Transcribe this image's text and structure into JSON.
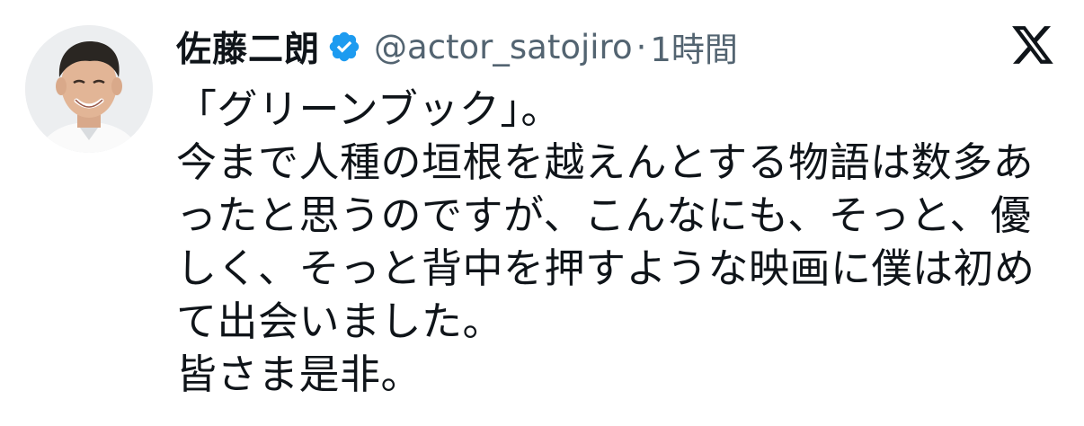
{
  "tweet": {
    "display_name": "佐藤二朗",
    "handle": "@actor_satojiro",
    "separator": "·",
    "timestamp": "1時間",
    "verified": true,
    "lines": [
      "「グリーンブック」。",
      "今まで人種の垣根を越えんとする物語は数多あ",
      "ったと思うのですが、こんなにも、そっと、優",
      "しく、そっと背中を押すような映画に僕は初め",
      "て出会いました。",
      "皆さま是非。"
    ]
  },
  "colors": {
    "text": "#0f1419",
    "secondary_text": "#536471",
    "verified_badge": "#1d9bf0",
    "background": "#ffffff"
  },
  "icons": {
    "verified": "verified-badge-icon",
    "platform": "x-logo-icon"
  }
}
